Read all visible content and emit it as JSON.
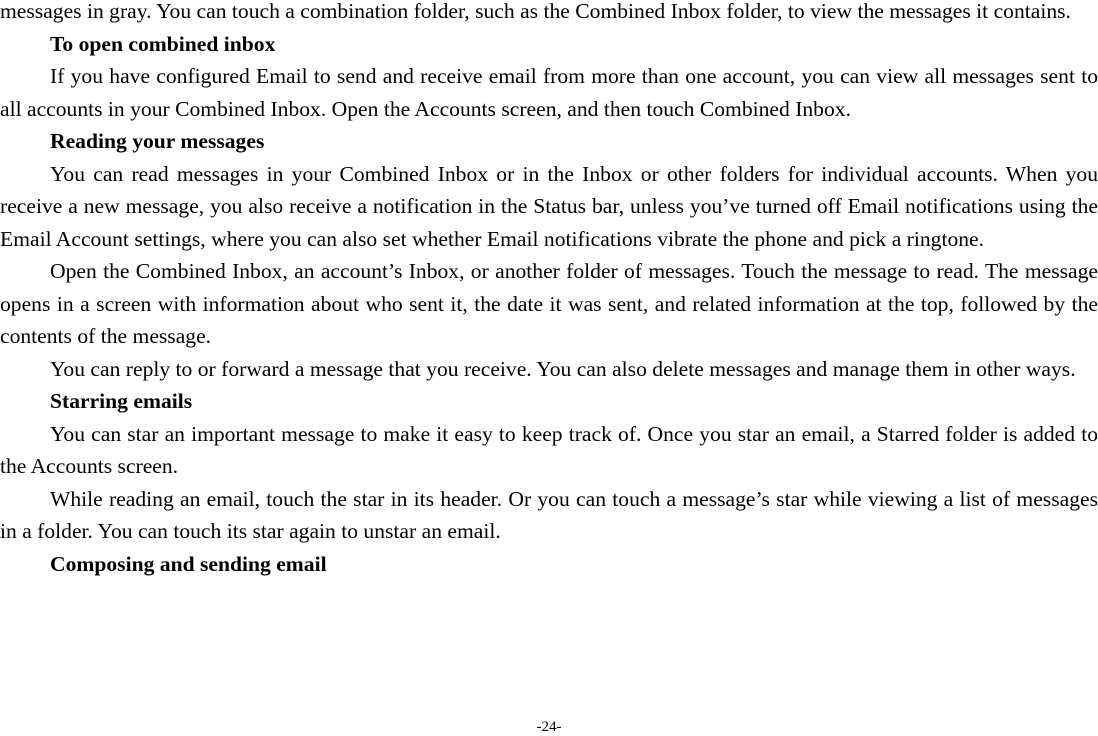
{
  "document": {
    "blocks": [
      {
        "type": "paragraph",
        "continuation": true,
        "text": "messages in gray. You can touch a combination folder, such as the Combined Inbox folder, to view the messages it contains."
      },
      {
        "type": "heading",
        "text": "To open combined inbox"
      },
      {
        "type": "paragraph",
        "text": "If you have configured Email to send and receive email from more than one account, you can view all messages sent to all accounts in your Combined Inbox. Open the Accounts screen, and then touch Combined Inbox."
      },
      {
        "type": "heading",
        "text": "Reading your messages"
      },
      {
        "type": "paragraph",
        "text": "You can read messages in your Combined Inbox or in the Inbox or other folders for individual accounts. When you receive a new message, you also receive a notification in the Status bar, unless you’ve turned off Email notifications using the Email Account settings, where you can also set whether Email notifications vibrate the phone and pick a ringtone."
      },
      {
        "type": "paragraph",
        "text": "Open the Combined Inbox, an account’s Inbox, or another folder of messages. Touch the message to read. The message opens in a screen with information about who sent it, the date it was sent, and related information at the top, followed by the contents of the message."
      },
      {
        "type": "paragraph",
        "text": "You can reply to or forward a message that you receive. You can also delete messages and manage them in other ways."
      },
      {
        "type": "heading",
        "text": "Starring emails"
      },
      {
        "type": "paragraph",
        "text": "You can star an important message to make it easy to keep track of. Once you star an email, a Starred folder is added to the Accounts screen."
      },
      {
        "type": "paragraph",
        "text": "While reading an email, touch the star in its header. Or you can touch a message’s star while viewing a list of messages in a folder. You can touch its star again to unstar an email."
      },
      {
        "type": "heading",
        "text": "Composing and sending email"
      }
    ]
  },
  "footer": {
    "page_number": "-24-"
  }
}
